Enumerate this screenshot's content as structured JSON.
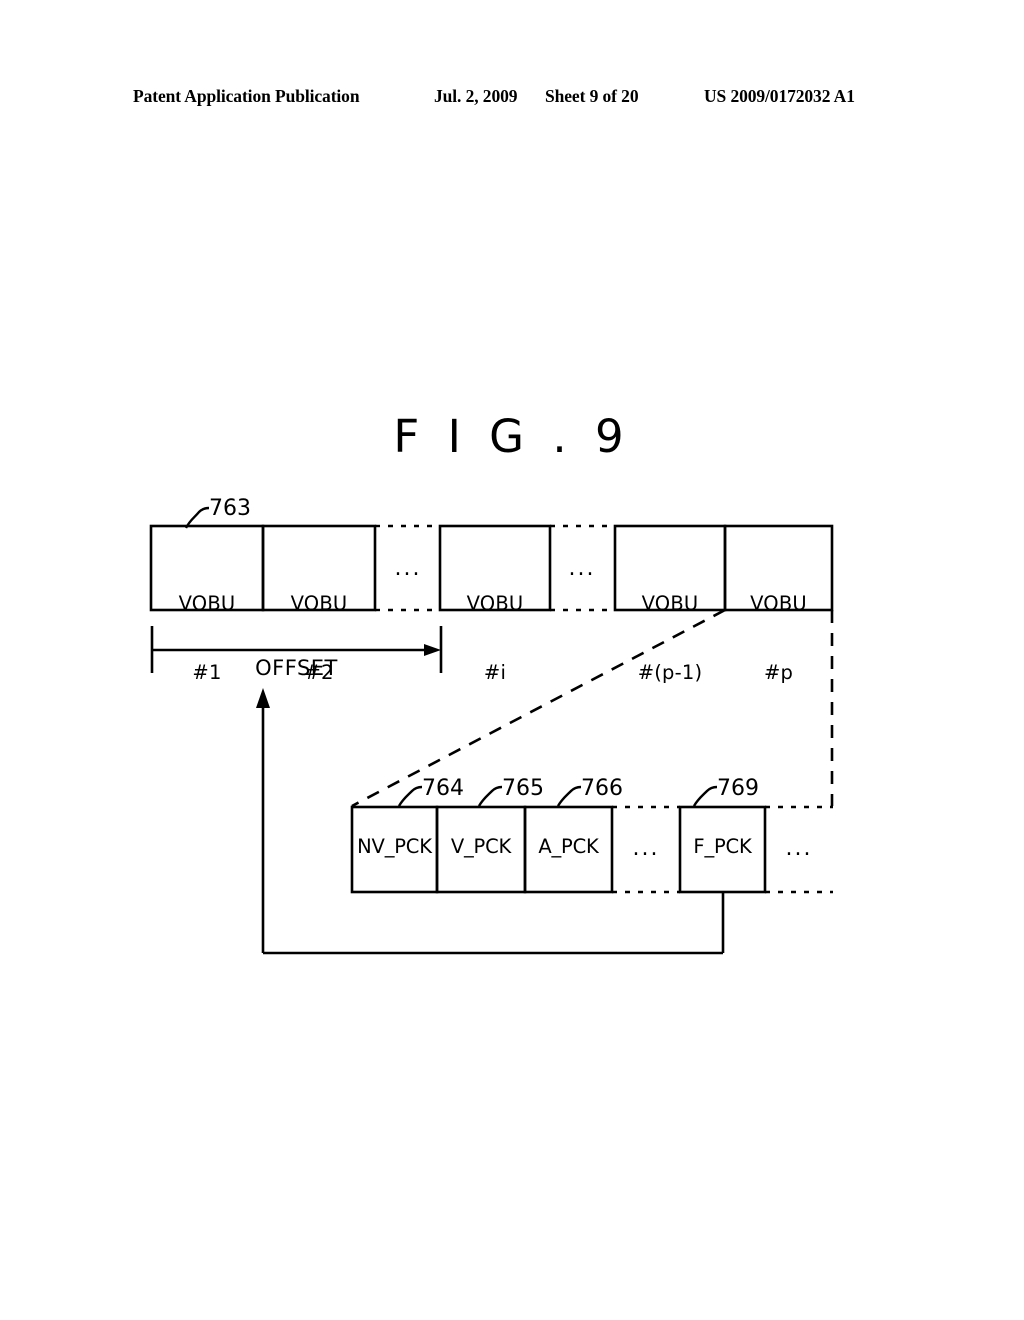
{
  "header": {
    "publication": "Patent Application Publication",
    "date": "Jul. 2, 2009",
    "sheet": "Sheet 9 of 20",
    "patent_number": "US 2009/0172032 A1"
  },
  "figure": {
    "title": "F I G . 9",
    "vobu_row": {
      "ref": "763",
      "boxes": [
        {
          "line1": "VOBU",
          "line2": "#1"
        },
        {
          "line1": "VOBU",
          "line2": "#2"
        },
        {
          "line1": "VOBU",
          "line2": "#i"
        },
        {
          "line1": "VOBU",
          "line2": "#(p-1)"
        },
        {
          "line1": "VOBU",
          "line2": "#p"
        }
      ],
      "ellipsis_1": "...",
      "ellipsis_2": "..."
    },
    "offset": {
      "label": "OFFSET"
    },
    "pck_row": {
      "boxes": [
        {
          "label": "NV_PCK",
          "ref": "764"
        },
        {
          "label": "V_PCK",
          "ref": "765"
        },
        {
          "label": "A_PCK",
          "ref": "766"
        },
        {
          "label": "F_PCK",
          "ref": "769"
        }
      ],
      "ellipsis_1": "...",
      "ellipsis_2": "..."
    }
  },
  "colors": {
    "ink": "#000000",
    "paper": "#ffffff"
  }
}
